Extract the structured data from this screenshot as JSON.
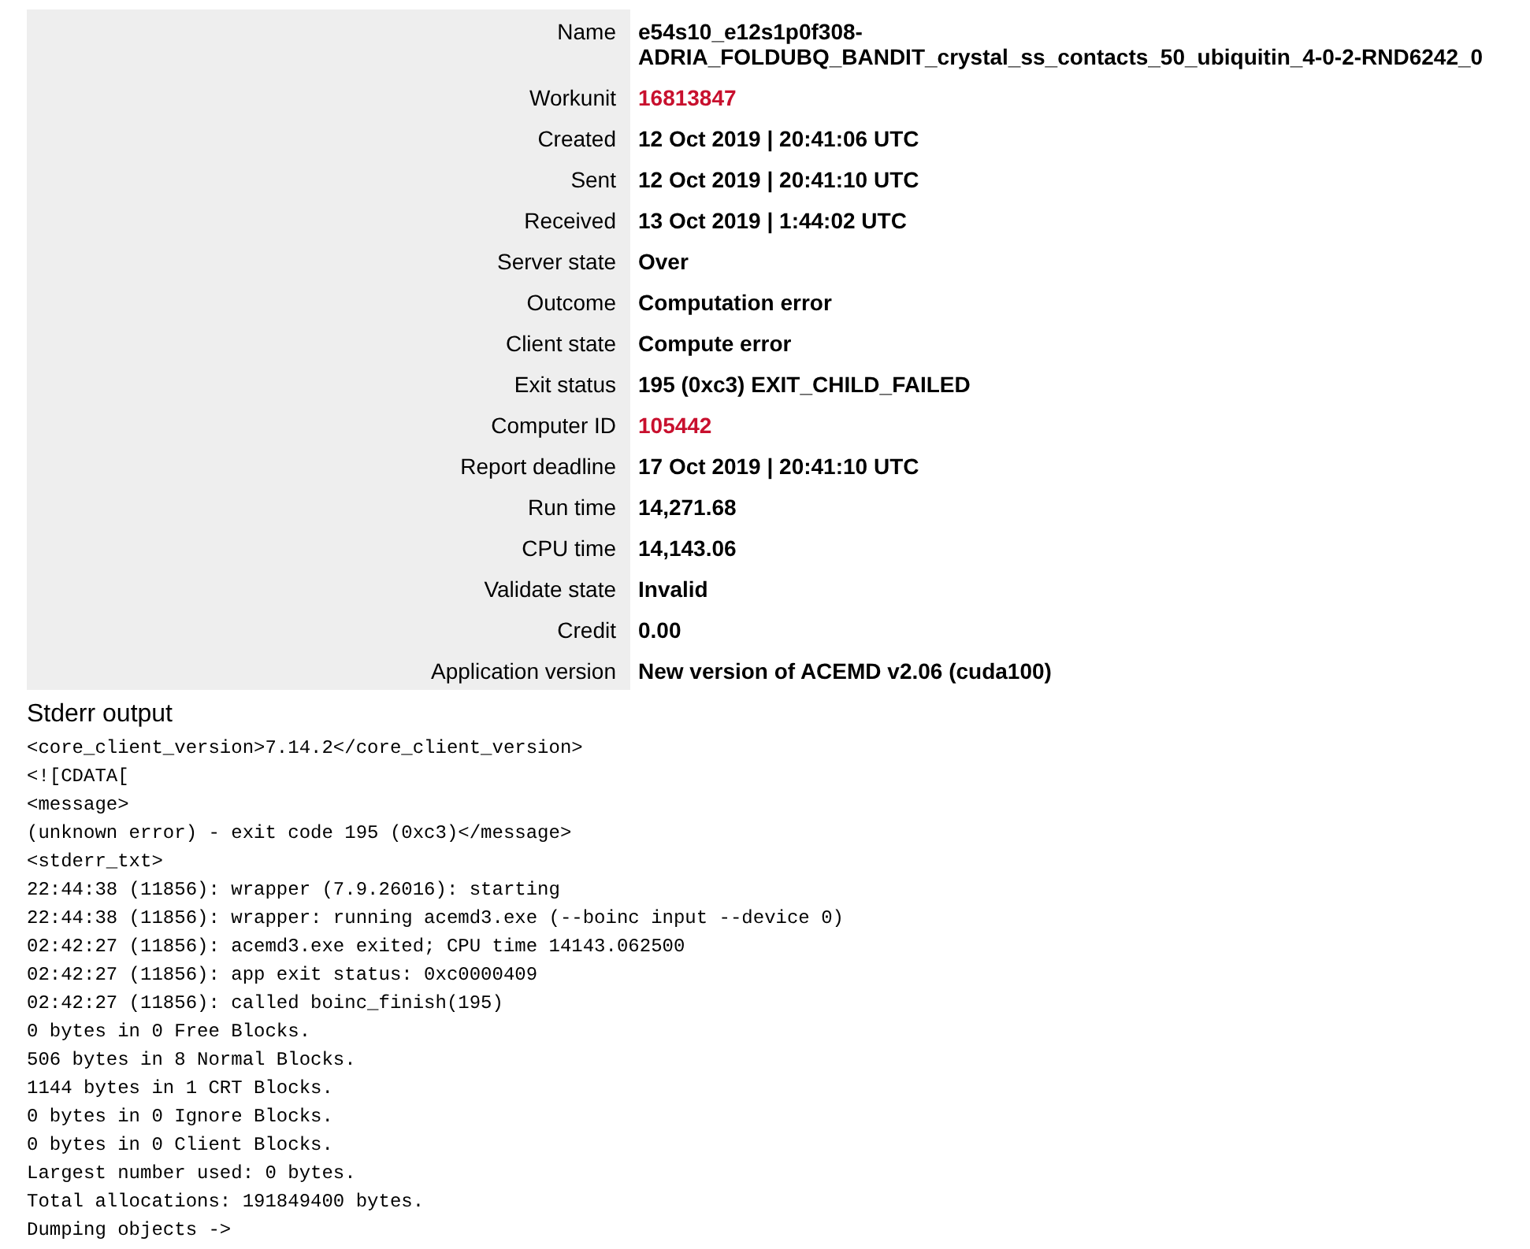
{
  "details": [
    {
      "label": "Name",
      "value": "e54s10_e12s1p0f308-ADRIA_FOLDUBQ_BANDIT_crystal_ss_contacts_50_ubiquitin_4-0-2-RND6242_0",
      "kind": "text"
    },
    {
      "label": "Workunit",
      "value": "16813847",
      "kind": "link"
    },
    {
      "label": "Created",
      "value": "12 Oct 2019 | 20:41:06 UTC",
      "kind": "text"
    },
    {
      "label": "Sent",
      "value": "12 Oct 2019 | 20:41:10 UTC",
      "kind": "text"
    },
    {
      "label": "Received",
      "value": "13 Oct 2019 | 1:44:02 UTC",
      "kind": "text"
    },
    {
      "label": "Server state",
      "value": "Over",
      "kind": "text"
    },
    {
      "label": "Outcome",
      "value": "Computation error",
      "kind": "text"
    },
    {
      "label": "Client state",
      "value": "Compute error",
      "kind": "text"
    },
    {
      "label": "Exit status",
      "value": "195 (0xc3) EXIT_CHILD_FAILED",
      "kind": "text"
    },
    {
      "label": "Computer ID",
      "value": "105442",
      "kind": "link"
    },
    {
      "label": "Report deadline",
      "value": "17 Oct 2019 | 20:41:10 UTC",
      "kind": "text"
    },
    {
      "label": "Run time",
      "value": "14,271.68",
      "kind": "text"
    },
    {
      "label": "CPU time",
      "value": "14,143.06",
      "kind": "text"
    },
    {
      "label": "Validate state",
      "value": "Invalid",
      "kind": "text"
    },
    {
      "label": "Credit",
      "value": "0.00",
      "kind": "text"
    },
    {
      "label": "Application version",
      "value": "New version of ACEMD v2.06 (cuda100)",
      "kind": "text"
    }
  ],
  "stderr": {
    "title": "Stderr output",
    "lines": [
      "<core_client_version>7.14.2</core_client_version>",
      "<![CDATA[",
      "<message>",
      "(unknown error) - exit code 195 (0xc3)</message>",
      "<stderr_txt>",
      "22:44:38 (11856): wrapper (7.9.26016): starting",
      "22:44:38 (11856): wrapper: running acemd3.exe (--boinc input --device 0)",
      "02:42:27 (11856): acemd3.exe exited; CPU time 14143.062500",
      "02:42:27 (11856): app exit status: 0xc0000409",
      "02:42:27 (11856): called boinc_finish(195)",
      "0 bytes in 0 Free Blocks.",
      "506 bytes in 8 Normal Blocks.",
      "1144 bytes in 1 CRT Blocks.",
      "0 bytes in 0 Ignore Blocks.",
      "0 bytes in 0 Client Blocks.",
      "Largest number used: 0 bytes.",
      "Total allocations: 191849400 bytes.",
      "Dumping objects ->"
    ]
  }
}
